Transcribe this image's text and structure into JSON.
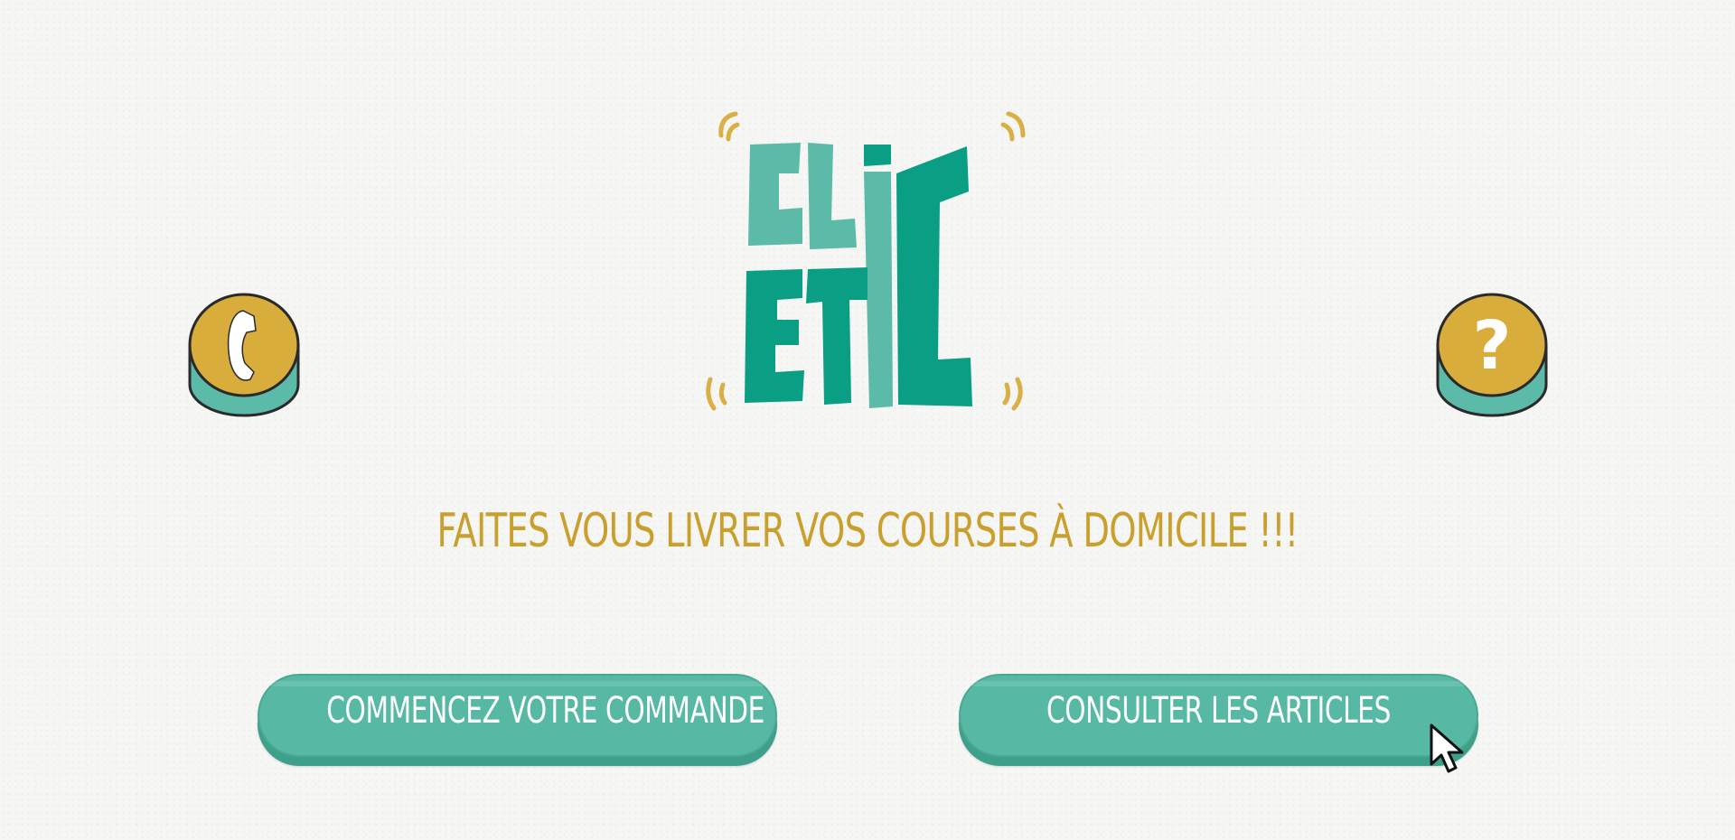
{
  "logo": {
    "line1": "CLiC",
    "line2": "ETIC",
    "brand_teal": "#0a9e84",
    "light_teal": "#5bbaa8",
    "accent_gold": "#d8b043"
  },
  "phone_button": {
    "icon": "phone-icon",
    "top_color": "#d8ad3c",
    "side_color": "#5bbaa8"
  },
  "help_button": {
    "icon": "question-mark-icon",
    "glyph": "?",
    "top_color": "#d8ad3c",
    "side_color": "#5bbaa8"
  },
  "tagline": "FAITES VOUS LIVRER VOS COURSES À DOMICILE !!!",
  "actions": {
    "start_order_label": "COMMENCEZ VOTRE COMMANDE",
    "browse_articles_label": "CONSULTER LES ARTICLES"
  },
  "colors": {
    "tagline": "#c9a02d",
    "button": "#57b9a4",
    "button_edge": "#3e9f8a",
    "background": "#f6f6f4"
  }
}
